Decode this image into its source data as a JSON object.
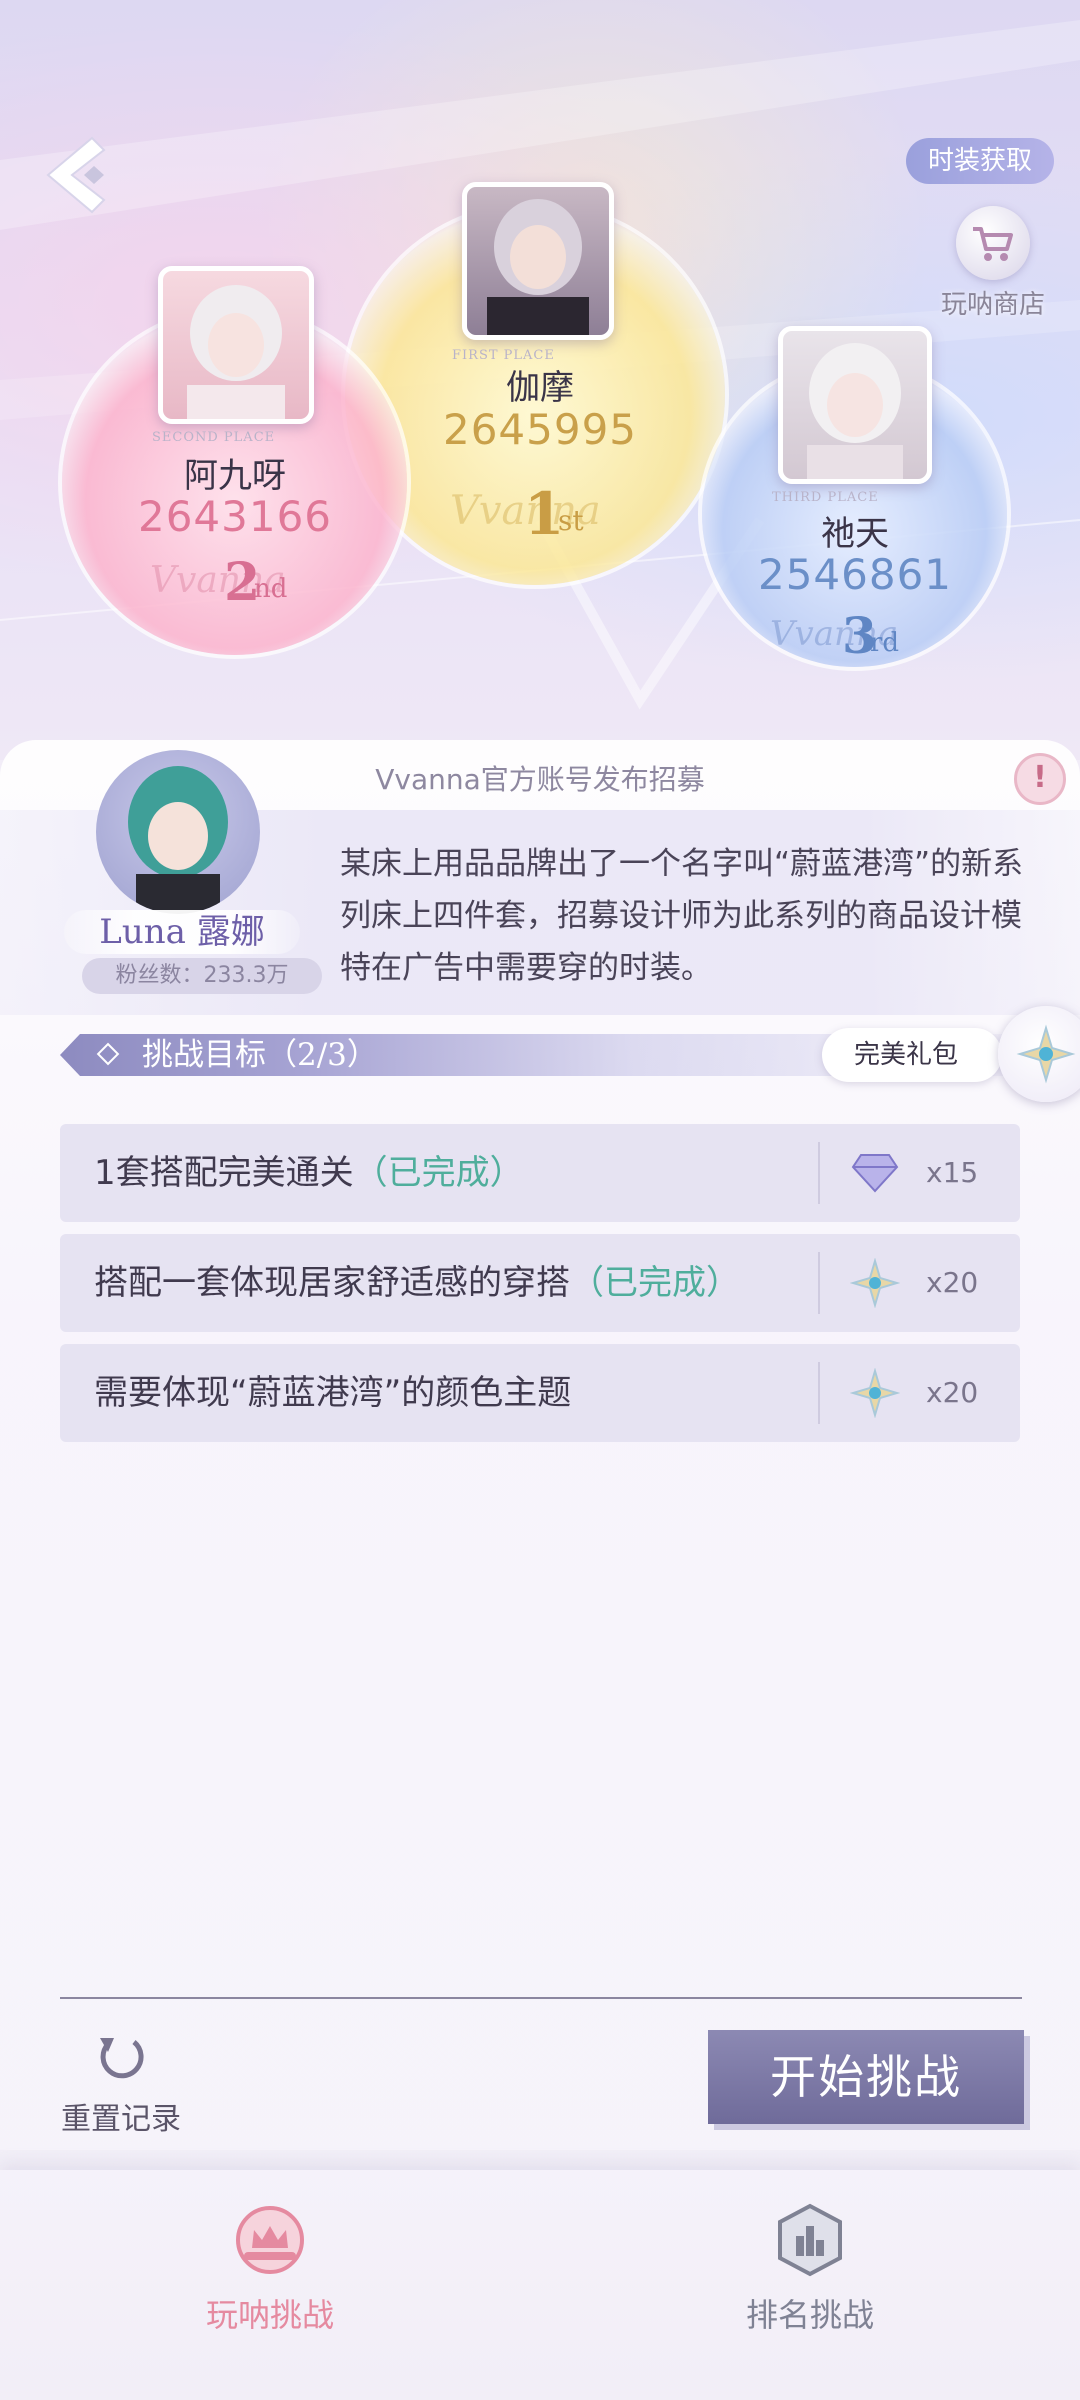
{
  "header": {
    "fashion_btn": "时装获取",
    "shop_label": "玩呐商店"
  },
  "podium": {
    "first": {
      "place": "FIRST PLACE",
      "name": "伽摩",
      "score": "2645995",
      "rank_num": "1",
      "rank_suffix": "st",
      "script": "Vvanna"
    },
    "second": {
      "place": "SECOND PLACE",
      "name": "阿九呀",
      "score": "2643166",
      "rank_num": "2",
      "rank_suffix": "nd",
      "script": "Vvanna"
    },
    "third": {
      "place": "THIRD PLACE",
      "name": "祂天",
      "score": "2546861",
      "rank_num": "3",
      "rank_suffix": "rd",
      "script": "Vvanna"
    }
  },
  "post": {
    "title": "Vvanna官方账号发布招募",
    "description": "某床上用品品牌出了一个名字叫“蔚蓝港湾”的新系列床上四件套，招募设计师为此系列的商品设计模特在广告中需要穿的时装。",
    "npc_name": "Luna 露娜",
    "npc_fans": "粉丝数：233.3万"
  },
  "goals": {
    "label": "挑战目标（2/3）",
    "gift_label": "完美礼包",
    "tasks": [
      {
        "text": "1套搭配完美通关",
        "status": "（已完成）",
        "reward_icon": "diamond-icon",
        "count": "x15"
      },
      {
        "text": "搭配一套体现居家舒适感的穿搭",
        "status": "（已完成）",
        "reward_icon": "star-emblem-icon",
        "count": "x20"
      },
      {
        "text": "需要体现“蔚蓝港湾”的颜色主题",
        "status": "",
        "reward_icon": "star-emblem-icon",
        "count": "x20"
      }
    ]
  },
  "actions": {
    "reset_label": "重置记录",
    "start_label": "开始挑战"
  },
  "tabs": [
    {
      "label": "玩呐挑战",
      "active": true
    },
    {
      "label": "排名挑战",
      "active": false
    }
  ],
  "colors": {
    "accent_green": "#4fae9c",
    "active_tab": "#e58aa0",
    "inactive_tab": "#7f8294",
    "button": "#7a76a6"
  }
}
